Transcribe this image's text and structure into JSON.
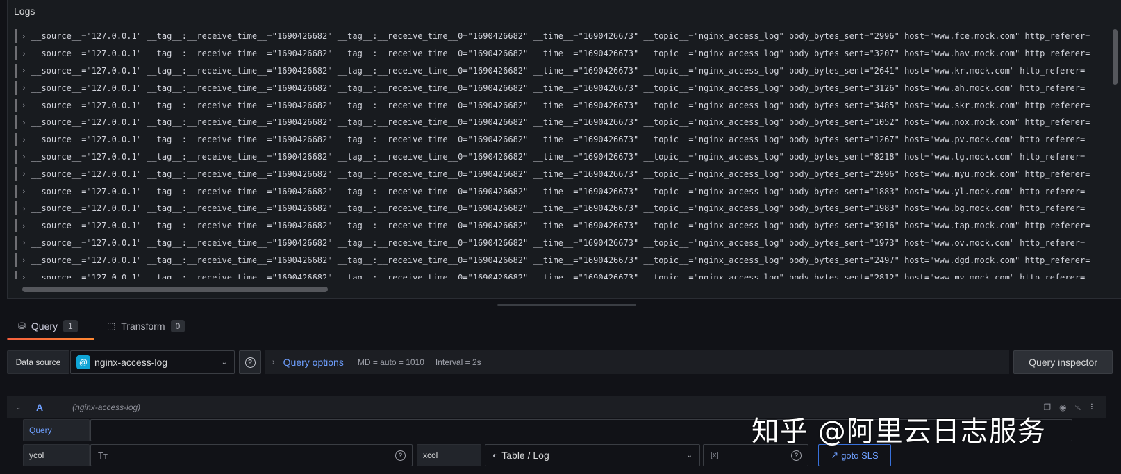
{
  "logs_panel": {
    "title": "Logs",
    "rows": [
      "__source__=\"127.0.0.1\" __tag__:__receive_time__=\"1690426682\" __tag__:__receive_time__0=\"1690426682\" __time__=\"1690426673\" __topic__=\"nginx_access_log\" body_bytes_sent=\"2996\" host=\"www.fce.mock.com\" http_referer=",
      "__source__=\"127.0.0.1\" __tag__:__receive_time__=\"1690426682\" __tag__:__receive_time__0=\"1690426682\" __time__=\"1690426673\" __topic__=\"nginx_access_log\" body_bytes_sent=\"3207\" host=\"www.hav.mock.com\" http_referer=",
      "__source__=\"127.0.0.1\" __tag__:__receive_time__=\"1690426682\" __tag__:__receive_time__0=\"1690426682\" __time__=\"1690426673\" __topic__=\"nginx_access_log\" body_bytes_sent=\"2641\" host=\"www.kr.mock.com\" http_referer=",
      "__source__=\"127.0.0.1\" __tag__:__receive_time__=\"1690426682\" __tag__:__receive_time__0=\"1690426682\" __time__=\"1690426673\" __topic__=\"nginx_access_log\" body_bytes_sent=\"3126\" host=\"www.ah.mock.com\" http_referer=",
      "__source__=\"127.0.0.1\" __tag__:__receive_time__=\"1690426682\" __tag__:__receive_time__0=\"1690426682\" __time__=\"1690426673\" __topic__=\"nginx_access_log\" body_bytes_sent=\"3485\" host=\"www.skr.mock.com\" http_referer=",
      "__source__=\"127.0.0.1\" __tag__:__receive_time__=\"1690426682\" __tag__:__receive_time__0=\"1690426682\" __time__=\"1690426673\" __topic__=\"nginx_access_log\" body_bytes_sent=\"1052\" host=\"www.nox.mock.com\" http_referer=",
      "__source__=\"127.0.0.1\" __tag__:__receive_time__=\"1690426682\" __tag__:__receive_time__0=\"1690426682\" __time__=\"1690426673\" __topic__=\"nginx_access_log\" body_bytes_sent=\"1267\" host=\"www.pv.mock.com\" http_referer=",
      "__source__=\"127.0.0.1\" __tag__:__receive_time__=\"1690426682\" __tag__:__receive_time__0=\"1690426682\" __time__=\"1690426673\" __topic__=\"nginx_access_log\" body_bytes_sent=\"8218\" host=\"www.lg.mock.com\" http_referer=",
      "__source__=\"127.0.0.1\" __tag__:__receive_time__=\"1690426682\" __tag__:__receive_time__0=\"1690426682\" __time__=\"1690426673\" __topic__=\"nginx_access_log\" body_bytes_sent=\"2996\" host=\"www.myu.mock.com\" http_referer=",
      "__source__=\"127.0.0.1\" __tag__:__receive_time__=\"1690426682\" __tag__:__receive_time__0=\"1690426682\" __time__=\"1690426673\" __topic__=\"nginx_access_log\" body_bytes_sent=\"1883\" host=\"www.yl.mock.com\" http_referer=",
      "__source__=\"127.0.0.1\" __tag__:__receive_time__=\"1690426682\" __tag__:__receive_time__0=\"1690426682\" __time__=\"1690426673\" __topic__=\"nginx_access_log\" body_bytes_sent=\"1983\" host=\"www.bg.mock.com\" http_referer=",
      "__source__=\"127.0.0.1\" __tag__:__receive_time__=\"1690426682\" __tag__:__receive_time__0=\"1690426682\" __time__=\"1690426673\" __topic__=\"nginx_access_log\" body_bytes_sent=\"3916\" host=\"www.tap.mock.com\" http_referer=",
      "__source__=\"127.0.0.1\" __tag__:__receive_time__=\"1690426682\" __tag__:__receive_time__0=\"1690426682\" __time__=\"1690426673\" __topic__=\"nginx_access_log\" body_bytes_sent=\"1973\" host=\"www.ov.mock.com\" http_referer=",
      "__source__=\"127.0.0.1\" __tag__:__receive_time__=\"1690426682\" __tag__:__receive_time__0=\"1690426682\" __time__=\"1690426673\" __topic__=\"nginx_access_log\" body_bytes_sent=\"2497\" host=\"www.dgd.mock.com\" http_referer=",
      "__source__=\"127.0.0.1\" __tag__:__receive_time__=\"1690426682\" __tag__:__receive_time__0=\"1690426682\" __time__=\"1690426673\" __topic__=\"nginx_access_log\" body_bytes_sent=\"2812\" host=\"www.mv.mock.com\" http_referer="
    ]
  },
  "tabs": {
    "query": {
      "label": "Query",
      "count": "1",
      "icon": "database-icon"
    },
    "transform": {
      "label": "Transform",
      "count": "0",
      "icon": "transform-icon"
    }
  },
  "datasource": {
    "label": "Data source",
    "selected": "nginx-access-log",
    "help": "?",
    "query_options_title": "Query options",
    "md": "MD = auto = 1010",
    "interval": "Interval = 2s",
    "inspector_label": "Query inspector"
  },
  "query_a": {
    "ref": "A",
    "ds_name": "(nginx-access-log)",
    "query_label": "Query",
    "query_value": "",
    "ycol_label": "ycol",
    "ycol_placeholder": "Tт",
    "xcol_label": "xcol",
    "xcol_value": "Table / Log",
    "extra_placeholder": "[x]",
    "goto_label": "goto SLS"
  },
  "watermark": "知乎 @阿里云日志服务",
  "colors": {
    "accent": "#6e9fff",
    "tab_underline": "#f55f3e",
    "background": "#111217"
  }
}
